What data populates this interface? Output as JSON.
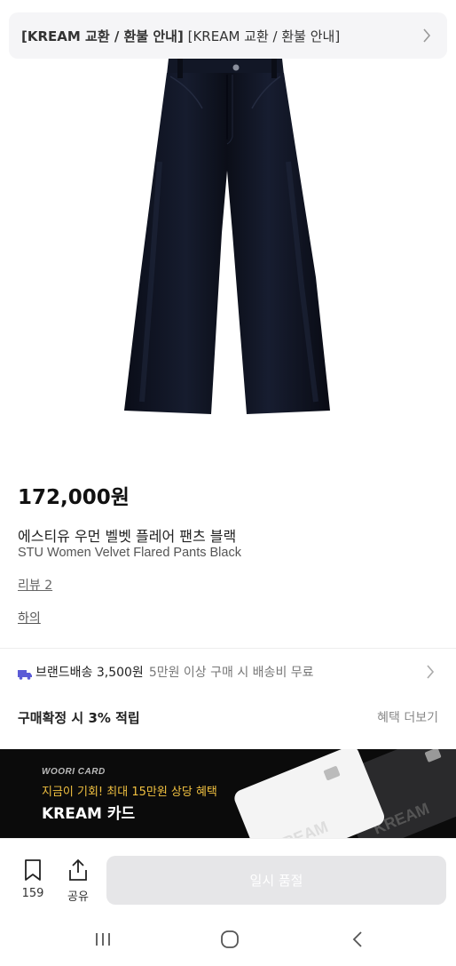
{
  "notice": {
    "bold_text": "[KREAM 교환 / 환불 안내]",
    "text": " [KREAM 교환 / 환불 안내]",
    "chevron_icon": "chevron-right-icon"
  },
  "product": {
    "price": "172,000원",
    "name_ko": "에스티유 우먼 벨벳 플레어 팬츠 블랙",
    "name_en": "STU Women Velvet Flared Pants Black",
    "review": "리뷰 2",
    "category": "하의"
  },
  "delivery": {
    "main": "브랜드배송 3,500원",
    "sub": "5만원 이상 구매 시 배송비 무료",
    "truck_color": "#5b5bd6"
  },
  "points": {
    "label": "구매확정 시 3% 적립",
    "more": "혜택 더보기"
  },
  "banner": {
    "tag": "WOORI CARD",
    "line": "지금이 기회! 최대 15만원 상당 혜택",
    "title": "KREAM 카드",
    "card_text": "KREAM"
  },
  "bottom": {
    "bookmark_count": "159",
    "share_label": "공유",
    "soldout_label": "일시 품절"
  },
  "colors": {
    "accent_yellow": "#f0c040",
    "disabled_button": "#e6e6e8"
  }
}
